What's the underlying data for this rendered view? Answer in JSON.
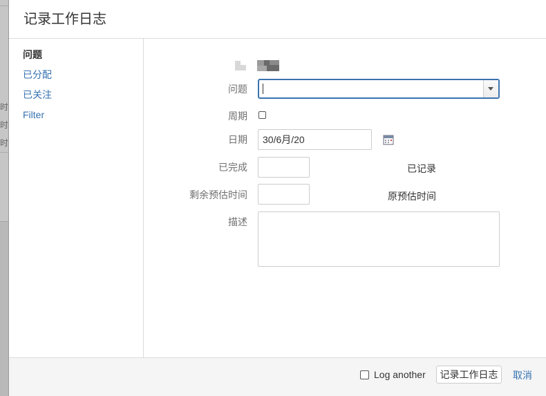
{
  "background": {
    "row_label": "时"
  },
  "dialog": {
    "title": "记录工作日志"
  },
  "sidebar": {
    "items": [
      {
        "label": "问题",
        "active": true
      },
      {
        "label": "已分配",
        "active": false
      },
      {
        "label": "已关注",
        "active": false
      },
      {
        "label": "Filter",
        "active": false
      }
    ]
  },
  "form": {
    "issue": {
      "label": "问题",
      "value": ""
    },
    "period": {
      "label": "周期",
      "checked": false
    },
    "date": {
      "label": "日期",
      "value": "30/6月/20"
    },
    "completed": {
      "label": "已完成",
      "value": ""
    },
    "logged": {
      "label": "已记录"
    },
    "remaining": {
      "label": "剩余预估时间",
      "value": ""
    },
    "original_estimate": {
      "label": "原预估时间"
    },
    "description": {
      "label": "描述",
      "value": ""
    }
  },
  "footer": {
    "log_another_label": "Log another",
    "log_another_checked": false,
    "submit_label": "记录工作日志",
    "cancel_label": "取消"
  },
  "colors": {
    "link": "#3572b0",
    "focus_border": "#3b73af",
    "text": "#333333",
    "label": "#707070"
  }
}
